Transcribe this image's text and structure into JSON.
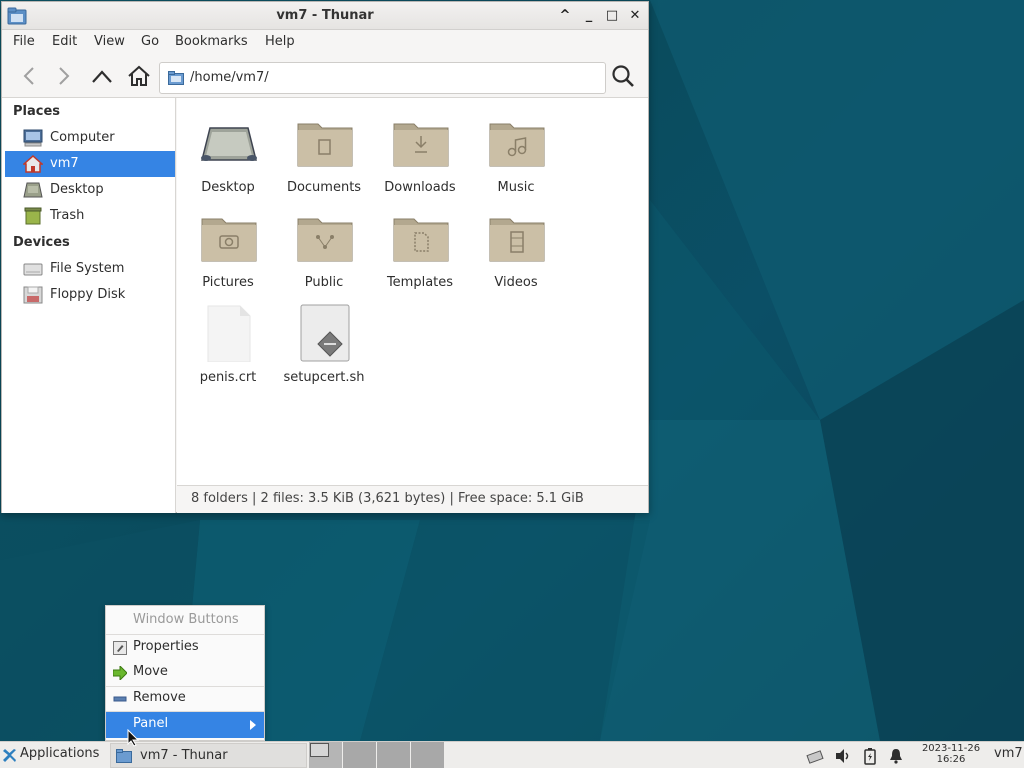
{
  "window": {
    "title": "vm7 - Thunar",
    "controls": [
      "^",
      "_",
      "□",
      "✕"
    ]
  },
  "menubar": {
    "items": [
      "File",
      "Edit",
      "View",
      "Go",
      "Bookmarks",
      "Help"
    ]
  },
  "toolbar": {
    "location": "/home/vm7/"
  },
  "sidebar": {
    "places_header": "Places",
    "devices_header": "Devices",
    "places": [
      {
        "label": "Computer",
        "icon": "computer-icon"
      },
      {
        "label": "vm7",
        "icon": "home-icon",
        "selected": true
      },
      {
        "label": "Desktop",
        "icon": "desktop-icon"
      },
      {
        "label": "Trash",
        "icon": "trash-icon"
      }
    ],
    "devices": [
      {
        "label": "File System",
        "icon": "drive-icon"
      },
      {
        "label": "Floppy Disk",
        "icon": "floppy-icon"
      }
    ]
  },
  "files": [
    {
      "name": "Desktop",
      "icon": "desktop-folder-icon"
    },
    {
      "name": "Documents",
      "icon": "documents-folder-icon"
    },
    {
      "name": "Downloads",
      "icon": "downloads-folder-icon"
    },
    {
      "name": "Music",
      "icon": "music-folder-icon"
    },
    {
      "name": "Pictures",
      "icon": "pictures-folder-icon"
    },
    {
      "name": "Public",
      "icon": "public-folder-icon"
    },
    {
      "name": "Templates",
      "icon": "templates-folder-icon"
    },
    {
      "name": "Videos",
      "icon": "videos-folder-icon"
    },
    {
      "name": "penis.crt",
      "icon": "blank-file-icon"
    },
    {
      "name": "setupcert.sh",
      "icon": "script-file-icon"
    }
  ],
  "status": "8 folders  |  2 files: 3.5 KiB (3,621 bytes)  |  Free space: 5.1 GiB",
  "context_menu": {
    "header": "Window Buttons",
    "items": [
      {
        "label": "Properties",
        "icon": "properties-icon"
      },
      {
        "label": "Move",
        "icon": "move-arrow-icon"
      },
      {
        "label": "Remove",
        "icon": "remove-icon"
      },
      {
        "label": "Panel",
        "icon": "submenu-arrow-icon",
        "selected": true
      }
    ]
  },
  "panel": {
    "applications": "Applications",
    "task": "vm7 - Thunar",
    "date": "2023-11-26",
    "time": "16:26",
    "user": "vm7"
  },
  "colors": {
    "accent": "#3584e4",
    "folder": "#cbbfa6",
    "desktop": "#0b4f66"
  }
}
